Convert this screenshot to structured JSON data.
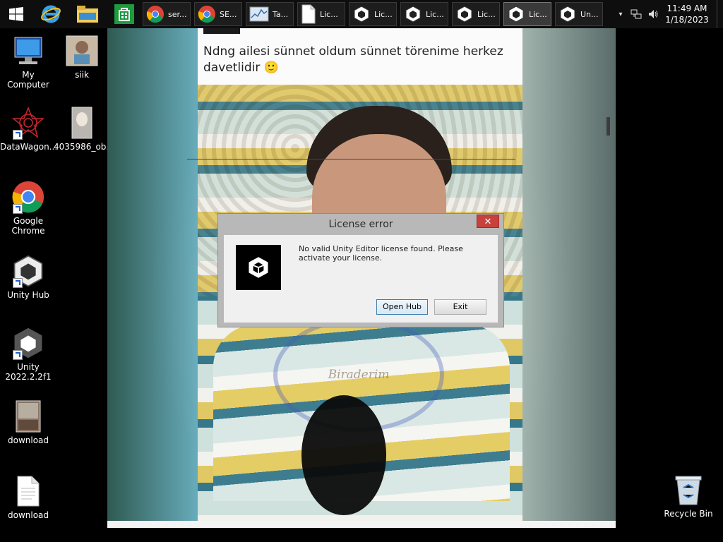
{
  "taskbar": {
    "start_icon": "windows-logo-icon",
    "pinned": [
      {
        "name": "internet-explorer-icon"
      },
      {
        "name": "file-explorer-icon"
      },
      {
        "name": "store-icon"
      }
    ],
    "windows": [
      {
        "icon": "chrome-icon",
        "label": "ser..."
      },
      {
        "icon": "chrome-icon",
        "label": "SE..."
      },
      {
        "icon": "task-manager-icon",
        "label": "Ta..."
      },
      {
        "icon": "document-icon",
        "label": "Lic..."
      },
      {
        "icon": "unity-icon",
        "label": "Lic..."
      },
      {
        "icon": "unity-icon",
        "label": "Lic..."
      },
      {
        "icon": "unity-icon",
        "label": "Lic..."
      },
      {
        "icon": "unity-icon",
        "label": "Lic..."
      },
      {
        "icon": "unity-icon",
        "label": "Un..."
      }
    ],
    "tray": {
      "arrow": "▾"
    },
    "clock": {
      "time": "11:49 AM",
      "date": "1/18/2023"
    }
  },
  "desktop": {
    "icons_left": [
      {
        "label": "My Computer",
        "icon": "computer-icon"
      },
      {
        "label": "DataWagon...",
        "icon": "datawagon-icon"
      },
      {
        "label": "Google Chrome",
        "icon": "chrome-icon"
      },
      {
        "label": "Unity Hub",
        "icon": "unity-icon"
      },
      {
        "label": "Unity 2022.2.2f1",
        "icon": "unity-icon"
      },
      {
        "label": "download",
        "icon": "image-file-icon"
      },
      {
        "label": "download",
        "icon": "text-file-icon"
      }
    ],
    "icons_second": [
      {
        "label": "siik",
        "icon": "image-file-icon"
      },
      {
        "label": "4035986_ob...",
        "icon": "image-file-icon"
      }
    ],
    "recycle_bin": {
      "label": "Recycle Bin",
      "icon": "recycle-bin-icon"
    }
  },
  "photo": {
    "post_text": "Ndng ailesi sünnet oldum sünnet törenime herkez davetlidir 🙂",
    "watermark": "Biraderim"
  },
  "dialog": {
    "title": "License error",
    "message": "No valid Unity Editor license found. Please activate your license.",
    "open_hub_label": "Open Hub",
    "exit_label": "Exit",
    "close_label": "✕"
  }
}
